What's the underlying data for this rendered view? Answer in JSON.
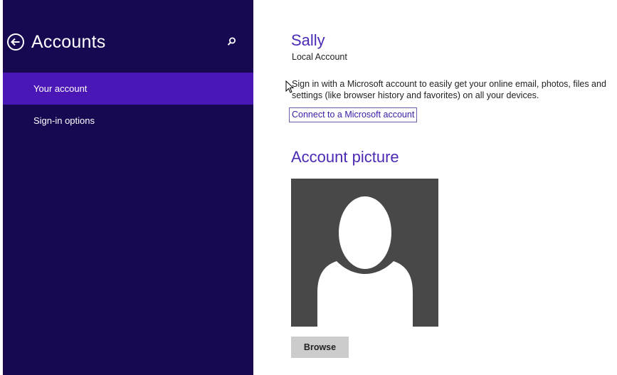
{
  "sidebar": {
    "title": "Accounts",
    "back_icon": "circle-back-arrow-icon",
    "search_icon": "search-icon",
    "items": [
      {
        "label": "Your account",
        "selected": true
      },
      {
        "label": "Sign-in options",
        "selected": false
      }
    ]
  },
  "account": {
    "name": "Sally",
    "type": "Local Account",
    "sign_in_message": "Sign in with a Microsoft account to easily get your online email, photos, files and settings (like browser history and favorites) on all your devices.",
    "connect_link": "Connect to a Microsoft account"
  },
  "picture": {
    "title": "Account picture",
    "avatar_icon": "default-user-silhouette-icon",
    "browse_label": "Browse"
  },
  "colors": {
    "sidebar_background": "#180852",
    "selected_item": "#4b16b6",
    "accent_text": "#4b2ab5",
    "avatar_background": "#484848",
    "button_background": "#cccccc"
  }
}
